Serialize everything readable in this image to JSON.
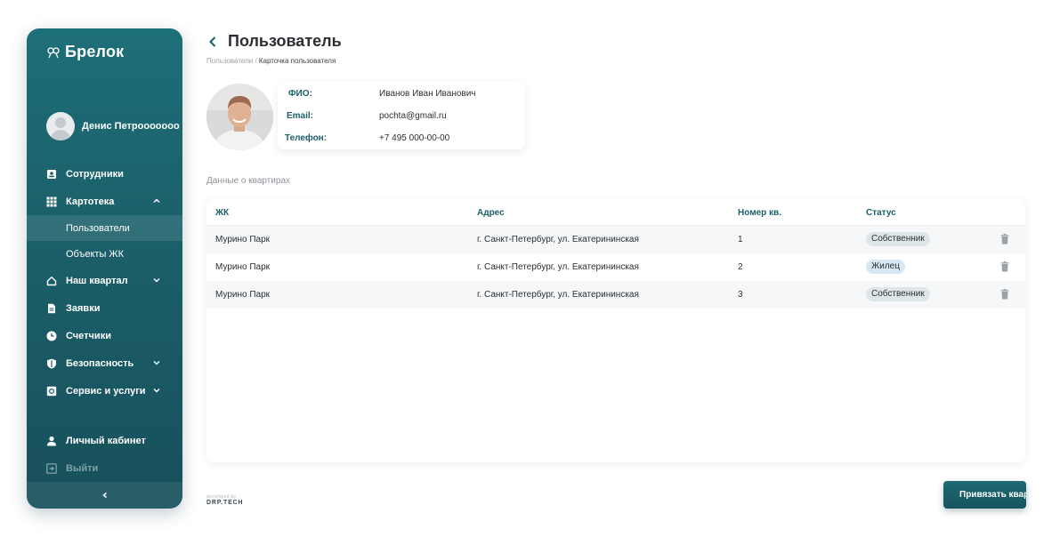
{
  "app": {
    "name": "Брелок"
  },
  "sidebar": {
    "profile_name": "Денис Петрооооооооо...",
    "items": [
      {
        "label": "Сотрудники",
        "icon": "badge-icon"
      },
      {
        "label": "Картотека",
        "icon": "grid-icon",
        "expanded": true
      },
      {
        "label": "Наш квартал",
        "icon": "home-icon"
      },
      {
        "label": "Заявки",
        "icon": "document-icon"
      },
      {
        "label": "Счетчики",
        "icon": "clock-icon"
      },
      {
        "label": "Безопасность",
        "icon": "shield-icon"
      },
      {
        "label": "Сервис и услуги",
        "icon": "service-icon"
      }
    ],
    "subitems": [
      {
        "label": "Пользователи",
        "active": true
      },
      {
        "label": "Объекты ЖК",
        "active": false
      }
    ],
    "bottom": {
      "cabinet": "Личный кабинет",
      "logout": "Выйти"
    }
  },
  "header": {
    "title": "Пользователь",
    "breadcrumb": {
      "parent": "Пользователи",
      "separator": " / ",
      "current": "Карточка пользователя"
    }
  },
  "user": {
    "fio_label": "ФИО:",
    "fio": "Иванов Иван Иванович",
    "email_label": "Email:",
    "email": "pochta@gmail.ru",
    "phone_label": "Телефон:",
    "phone": "+7 495 000-00-00"
  },
  "section_title": "Данные о квартирах",
  "table": {
    "columns": [
      "ЖК",
      "Адрес",
      "Номер кв.",
      "Статус"
    ],
    "rows": [
      {
        "complex": "Мурино Парк",
        "address": "г. Санкт-Петербург, ул. Екатерининская",
        "number": "1",
        "status": "Собственник"
      },
      {
        "complex": "Мурино Парк",
        "address": "г. Санкт-Петербург, ул. Екатерининская",
        "number": "2",
        "status": "Жилец"
      },
      {
        "complex": "Мурино Парк",
        "address": "г. Санкт-Петербург, ул. Екатерининская",
        "number": "3",
        "status": "Собственник"
      }
    ]
  },
  "footer": {
    "small": "developed by",
    "brand": "DRP.TECH"
  },
  "actions": {
    "bind_button": "Привязать квар"
  },
  "colors": {
    "accent": "#1b5f69",
    "sidebar_top": "#1d6f78",
    "sidebar_bottom": "#17505b"
  }
}
